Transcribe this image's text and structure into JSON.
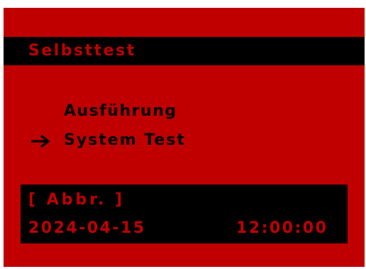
{
  "header": {
    "title": "Selbsttest"
  },
  "menu": {
    "items": [
      {
        "label": "Ausführung",
        "selected": false
      },
      {
        "label": "System Test",
        "selected": true
      }
    ],
    "cursor_icon": "arrow-right-icon"
  },
  "footer": {
    "softkey_label": "[ Abbr.  ]",
    "date": "2024-04-15",
    "time": "12:00:00"
  },
  "colors": {
    "background": "#c00000",
    "bar": "#000000",
    "text_on_bar": "#c00000",
    "text_on_background": "#000000"
  }
}
